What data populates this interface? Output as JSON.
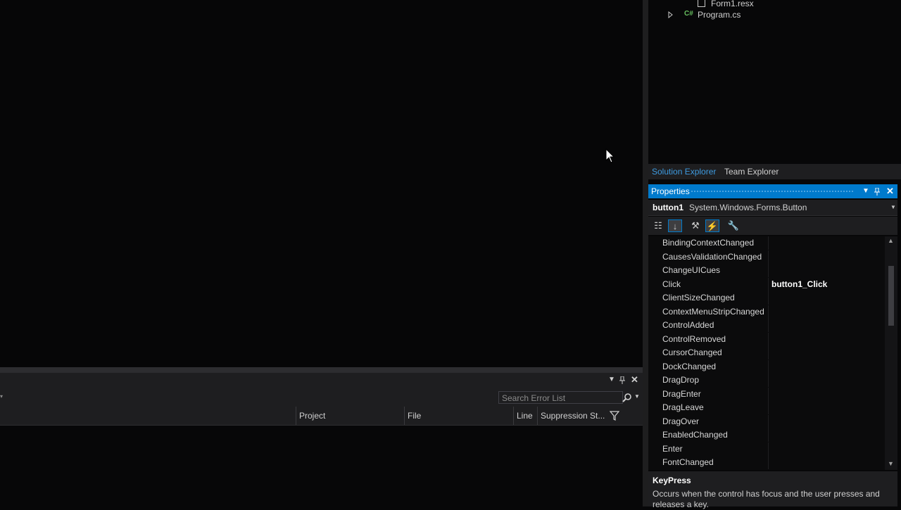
{
  "solution_explorer": {
    "items": [
      {
        "label": "Form1.resx",
        "icon": "resx-file-icon"
      },
      {
        "label": "Program.cs",
        "icon": "csharp-file-icon"
      }
    ],
    "tabs": [
      "Solution Explorer",
      "Team Explorer"
    ]
  },
  "properties": {
    "title": "Properties",
    "object_name": "button1",
    "object_type": "System.Windows.Forms.Button",
    "events": [
      {
        "name": "BindingContextChanged",
        "value": ""
      },
      {
        "name": "CausesValidationChanged",
        "value": ""
      },
      {
        "name": "ChangeUICues",
        "value": ""
      },
      {
        "name": "Click",
        "value": "button1_Click"
      },
      {
        "name": "ClientSizeChanged",
        "value": ""
      },
      {
        "name": "ContextMenuStripChanged",
        "value": ""
      },
      {
        "name": "ControlAdded",
        "value": ""
      },
      {
        "name": "ControlRemoved",
        "value": ""
      },
      {
        "name": "CursorChanged",
        "value": ""
      },
      {
        "name": "DockChanged",
        "value": ""
      },
      {
        "name": "DragDrop",
        "value": ""
      },
      {
        "name": "DragEnter",
        "value": ""
      },
      {
        "name": "DragLeave",
        "value": ""
      },
      {
        "name": "DragOver",
        "value": ""
      },
      {
        "name": "EnabledChanged",
        "value": ""
      },
      {
        "name": "Enter",
        "value": ""
      },
      {
        "name": "FontChanged",
        "value": ""
      }
    ],
    "description": {
      "title": "KeyPress",
      "text": "Occurs when the control has focus and the user presses and releases a key."
    }
  },
  "error_list": {
    "search_placeholder": "Search Error List",
    "columns": [
      "Project",
      "File",
      "Line",
      "Suppression St..."
    ]
  },
  "colors": {
    "accent": "#007acc",
    "background": "#070708",
    "panel": "#1e1e20"
  }
}
